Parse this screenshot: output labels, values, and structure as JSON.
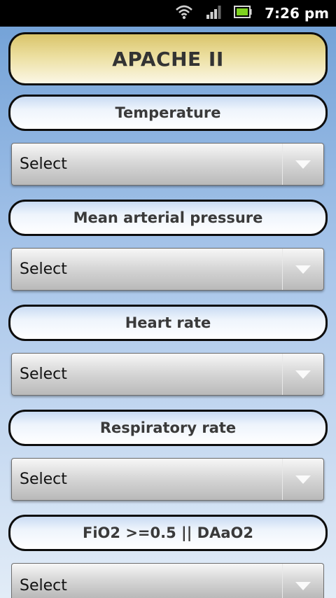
{
  "status_bar": {
    "time": "7:26 pm",
    "icons": [
      "wifi-icon",
      "signal-icon",
      "battery-icon"
    ]
  },
  "app": {
    "title": "APACHE II"
  },
  "fields": [
    {
      "label": "Temperature",
      "value": "Select"
    },
    {
      "label": "Mean arterial pressure",
      "value": "Select"
    },
    {
      "label": "Heart rate",
      "value": "Select"
    },
    {
      "label": "Respiratory rate",
      "value": "Select"
    },
    {
      "label": "FiO2 >=0.5 || DAaO2",
      "value": "Select"
    }
  ],
  "colors": {
    "title_gold": "#d9c46a",
    "label_blue": "#c9dbf3",
    "background_blue": "#6f9fd6",
    "battery_green": "#7fd321"
  }
}
